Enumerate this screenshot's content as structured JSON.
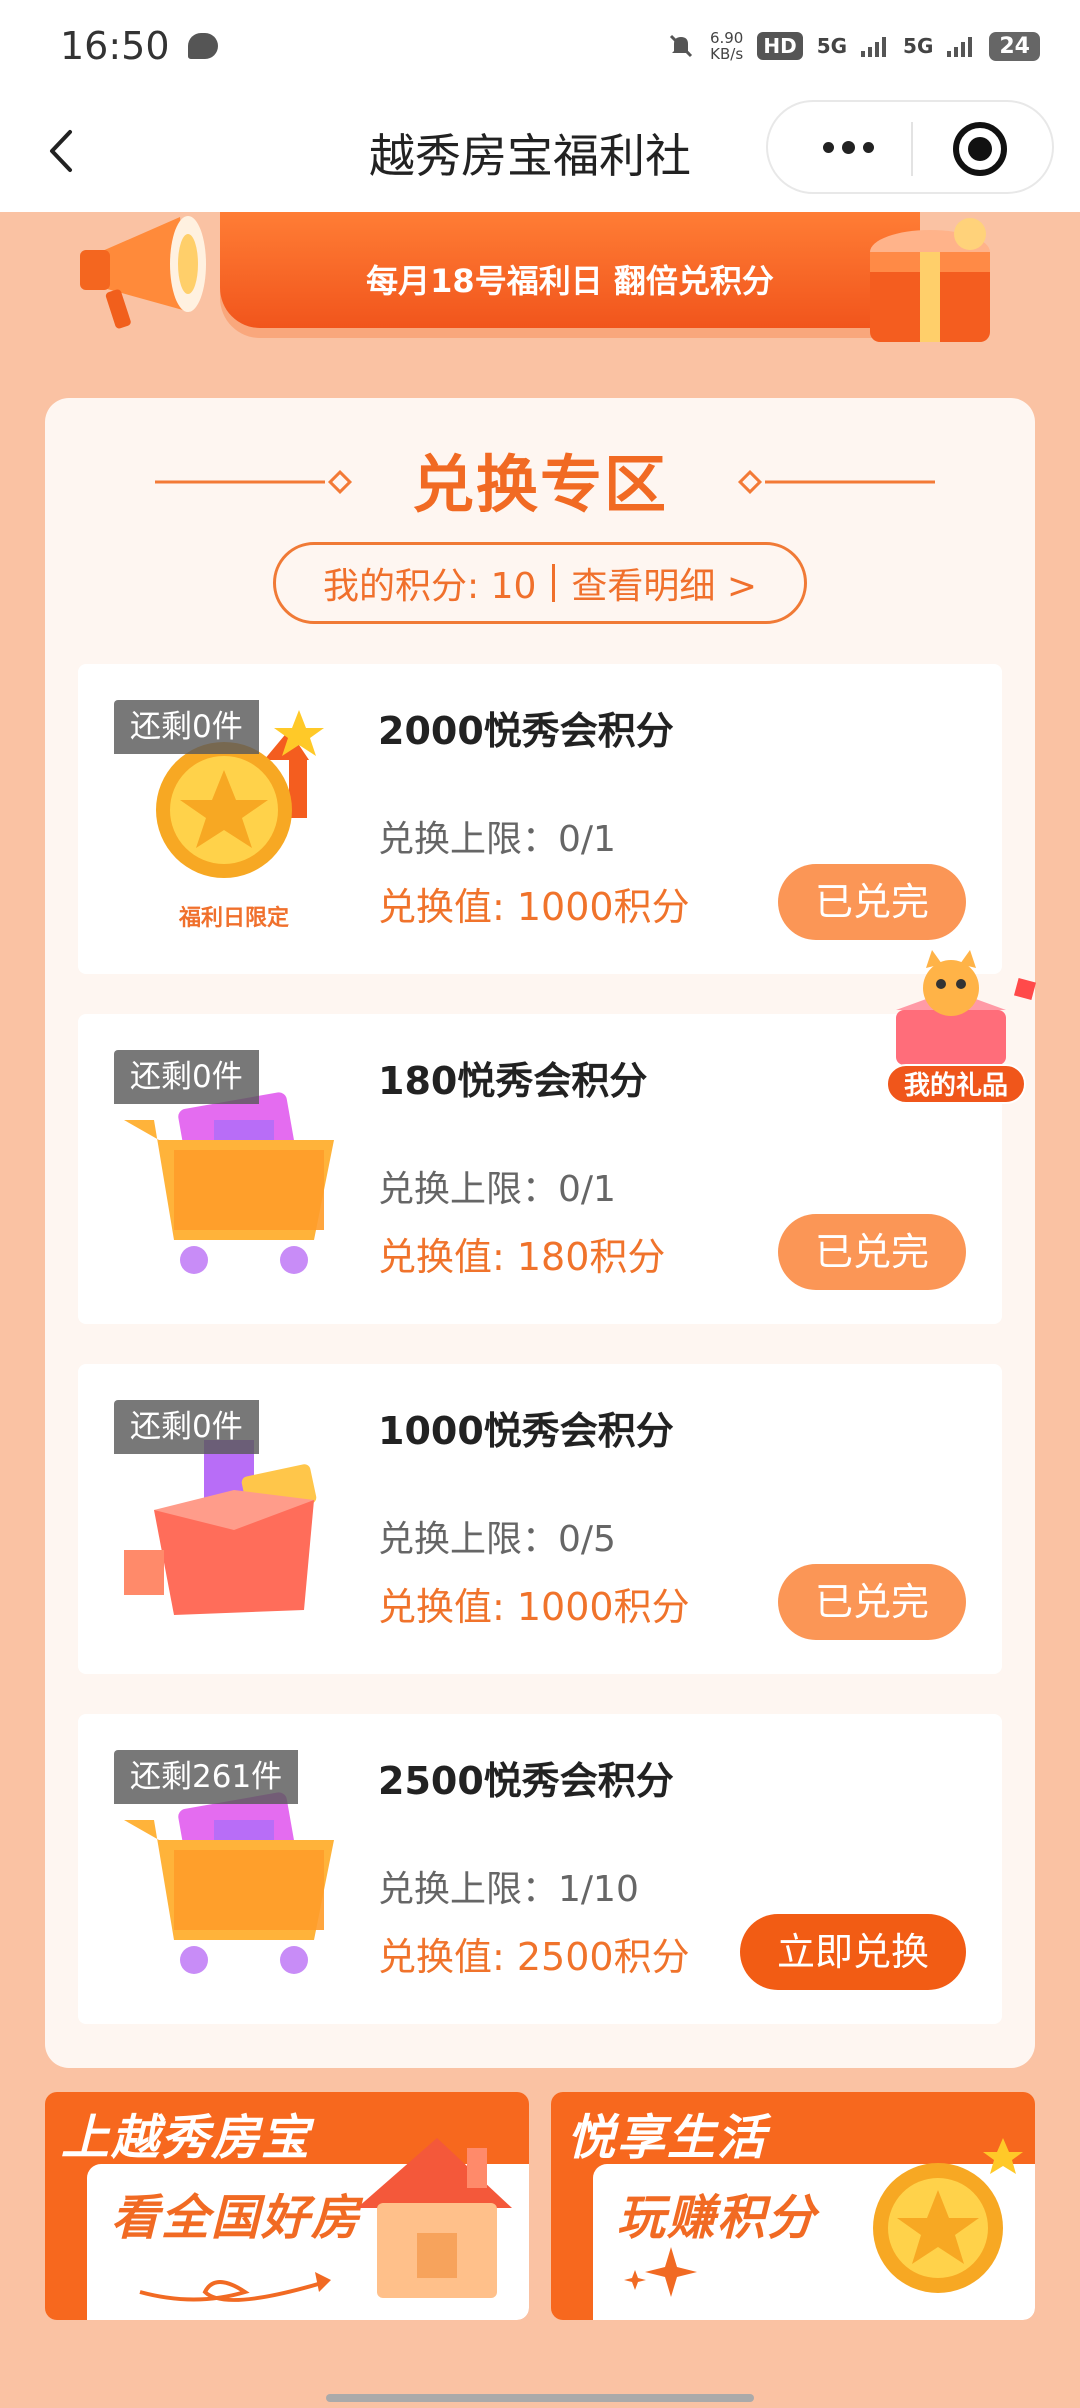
{
  "status_bar": {
    "time": "16:50",
    "speed_value": "6.90",
    "speed_unit": "KB/s",
    "hd": "HD",
    "signal_1": "5G",
    "signal_2": "5G",
    "battery": "24"
  },
  "title_bar": {
    "title": "越秀房宝福利社"
  },
  "banner": {
    "subtitle": "每月18号福利日 翻倍兑积分"
  },
  "section": {
    "title": "兑换专区",
    "points_label": "我的积分: 10",
    "detail_link": "查看明细 >"
  },
  "items": [
    {
      "stock": "还剩0件",
      "name": "2000悦秀会积分",
      "limit": "兑换上限：0/1",
      "price": "兑换值: 1000积分",
      "button": "已兑完",
      "image_caption": "福利日限定"
    },
    {
      "stock": "还剩0件",
      "name": "180悦秀会积分",
      "limit": "兑换上限：0/1",
      "price": "兑换值: 180积分",
      "button": "已兑完"
    },
    {
      "stock": "还剩0件",
      "name": "1000悦秀会积分",
      "limit": "兑换上限：0/5",
      "price": "兑换值: 1000积分",
      "button": "已兑完"
    },
    {
      "stock": "还剩261件",
      "name": "2500悦秀会积分",
      "limit": "兑换上限：1/10",
      "price": "兑换值: 2500积分",
      "button": "立即兑换"
    }
  ],
  "floating": {
    "label": "我的礼品"
  },
  "promos": [
    {
      "head": "上越秀房宝",
      "sub": "看全国好房"
    },
    {
      "head": "悦享生活",
      "sub": "玩赚积分"
    }
  ],
  "colors": {
    "accent": "#f16a23",
    "button_done": "#fb9656",
    "button_active": "#f25c14",
    "page_bg": "#fac2a3"
  }
}
